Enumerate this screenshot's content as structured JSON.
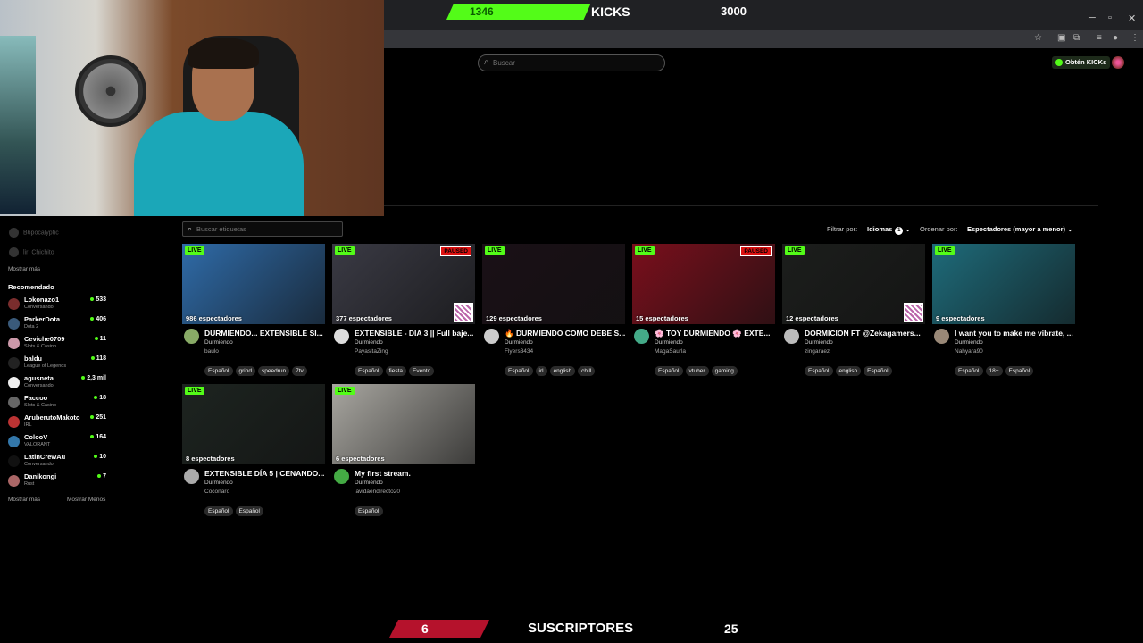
{
  "overlay": {
    "kicks_goal": {
      "current": "1346",
      "label": "KICKS",
      "target": "3000",
      "progress": 0.4487,
      "color": "#53fc18"
    },
    "subs_goal": {
      "current": "6",
      "label": "SUSCRIPTORES",
      "target": "25",
      "progress": 0.24,
      "color": "#b5122c"
    }
  },
  "header": {
    "search_placeholder": "Buscar",
    "get_kicks_label": "Obtén KICKs"
  },
  "sidebar": {
    "ghost_items": [
      "B6pocalyptic",
      "lir_Chichito"
    ],
    "show_more_top": "Mostrar más",
    "recommended_title": "Recomendado",
    "recommended": [
      {
        "name": "Lokonazo1",
        "category": "Conversando",
        "viewers": "533",
        "avatar": "#7a2d2d"
      },
      {
        "name": "ParkerDota",
        "category": "Dota 2",
        "viewers": "406",
        "avatar": "#3a5a7a"
      },
      {
        "name": "Ceviche0709",
        "category": "Slots & Casino",
        "viewers": "11",
        "avatar": "#c9a"
      },
      {
        "name": "baldu",
        "category": "League of Legends",
        "viewers": "118",
        "avatar": "#222"
      },
      {
        "name": "agusneta",
        "category": "Conversando",
        "viewers": "2,3 mil",
        "avatar": "#eee"
      },
      {
        "name": "Faccoo",
        "category": "Slots & Casino",
        "viewers": "18",
        "avatar": "#666"
      },
      {
        "name": "AruberutoMakoto",
        "category": "IRL",
        "viewers": "251",
        "avatar": "#b33"
      },
      {
        "name": "ColooV",
        "category": "VALORANT",
        "viewers": "164",
        "avatar": "#37a"
      },
      {
        "name": "LatinCrewAu",
        "category": "Conversando",
        "viewers": "10",
        "avatar": "#111"
      },
      {
        "name": "Danikongi",
        "category": "Rust",
        "viewers": "7",
        "avatar": "#a66"
      }
    ],
    "show_more_bottom": "Mostrar más",
    "show_less": "Mostrar Menos"
  },
  "browse": {
    "tag_search_placeholder": "Buscar etiquetas",
    "filter_label": "Filtrar por:",
    "language_filter": "Idiomas",
    "language_count": "1",
    "sort_label": "Ordenar por:",
    "sort_value": "Espectadores (mayor a menor)",
    "live_label": "LIVE",
    "paused_label": "PAUSED"
  },
  "streams": [
    {
      "viewers": "986 espectadores",
      "title": "DURMIENDO... EXTENSIBLE SI...",
      "category": "Durmiendo",
      "user": "baulo",
      "tags": [
        "Español",
        "grind",
        "speedrun",
        "7tv"
      ],
      "thumb": "#2f6ba8",
      "avatar": "#8a6"
    },
    {
      "viewers": "377 espectadores",
      "title": "EXTENSIBLE - DIA 3 || Full baje...",
      "category": "Durmiendo",
      "user": "PayasitaZing",
      "tags": [
        "Español",
        "fiesta",
        "Evento"
      ],
      "thumb": "#3a3a44",
      "avatar": "#ddd"
    },
    {
      "viewers": "129 espectadores",
      "title": "🔥 DURMIENDO COMO DEBE S...",
      "category": "Durmiendo",
      "user": "Flyers3434",
      "tags": [
        "Español",
        "irl",
        "english",
        "chill"
      ],
      "thumb": "#1a1016",
      "avatar": "#ccc"
    },
    {
      "viewers": "15 espectadores",
      "title": "🌸 TOY DURMIENDO 🌸 EXTE...",
      "category": "Durmiendo",
      "user": "MagaSaurla",
      "tags": [
        "Español",
        "vtuber",
        "gaming"
      ],
      "thumb": "#7a0f1c",
      "avatar": "#4a8"
    },
    {
      "viewers": "12 espectadores",
      "title": "DORMICION FT @Zekagamers...",
      "category": "Durmiendo",
      "user": "zingaraez",
      "tags": [
        "Español",
        "english",
        "Español"
      ],
      "thumb": "#1c1e1c",
      "avatar": "#bbb"
    },
    {
      "viewers": "9 espectadores",
      "title": "I want you to make me vibrate, ...",
      "category": "Durmiendo",
      "user": "Nahyara90",
      "tags": [
        "Español",
        "18+",
        "Español"
      ],
      "thumb": "#1e6b7a",
      "avatar": "#987"
    },
    {
      "viewers": "8 espectadores",
      "title": "EXTENSIBLE DÍA 5 | CENANDO...",
      "category": "Durmiendo",
      "user": "Coconaro",
      "tags": [
        "Español",
        "Español"
      ],
      "thumb": "#1d2420",
      "avatar": "#aaa"
    },
    {
      "viewers": "6 espectadores",
      "title": "My first stream.",
      "category": "Durmiendo",
      "user": "lavidaendirecto20",
      "tags": [
        "Español"
      ],
      "thumb": "#a8a6a0",
      "avatar": "#4a4"
    }
  ]
}
